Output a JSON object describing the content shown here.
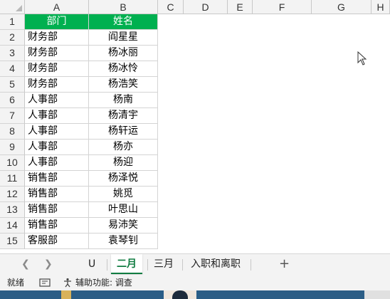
{
  "columns": [
    "A",
    "B",
    "C",
    "D",
    "E",
    "F",
    "G",
    "H"
  ],
  "header_row": {
    "row_no": "1",
    "dept": "部门",
    "name": "姓名"
  },
  "rows": [
    {
      "row_no": "2",
      "dept": "财务部",
      "name": "阎星星"
    },
    {
      "row_no": "3",
      "dept": "财务部",
      "name": "杨冰丽"
    },
    {
      "row_no": "4",
      "dept": "财务部",
      "name": "杨冰怜"
    },
    {
      "row_no": "5",
      "dept": "财务部",
      "name": "杨浩笑"
    },
    {
      "row_no": "6",
      "dept": "人事部",
      "name": "杨南"
    },
    {
      "row_no": "7",
      "dept": "人事部",
      "name": "杨清宇"
    },
    {
      "row_no": "8",
      "dept": "人事部",
      "name": "杨轩运"
    },
    {
      "row_no": "9",
      "dept": "人事部",
      "name": "杨亦"
    },
    {
      "row_no": "10",
      "dept": "人事部",
      "name": "杨迎"
    },
    {
      "row_no": "11",
      "dept": "销售部",
      "name": "杨泽悦"
    },
    {
      "row_no": "12",
      "dept": "销售部",
      "name": "姚觅"
    },
    {
      "row_no": "13",
      "dept": "销售部",
      "name": "叶思山"
    },
    {
      "row_no": "14",
      "dept": "销售部",
      "name": "易沛笑"
    },
    {
      "row_no": "15",
      "dept": "客服部",
      "name": "袁琴钊"
    }
  ],
  "header_color": "#00b050",
  "sheet_tabs": {
    "prev_icon": "chevron-left-icon",
    "next_icon": "chevron-right-icon",
    "tab_u": "U",
    "tab_feb": "二月",
    "tab_mar": "三月",
    "tab_onboard": "入职和离职",
    "add": "+"
  },
  "status": {
    "ready": "就绪",
    "accessibility": "辅助功能: 调查"
  }
}
